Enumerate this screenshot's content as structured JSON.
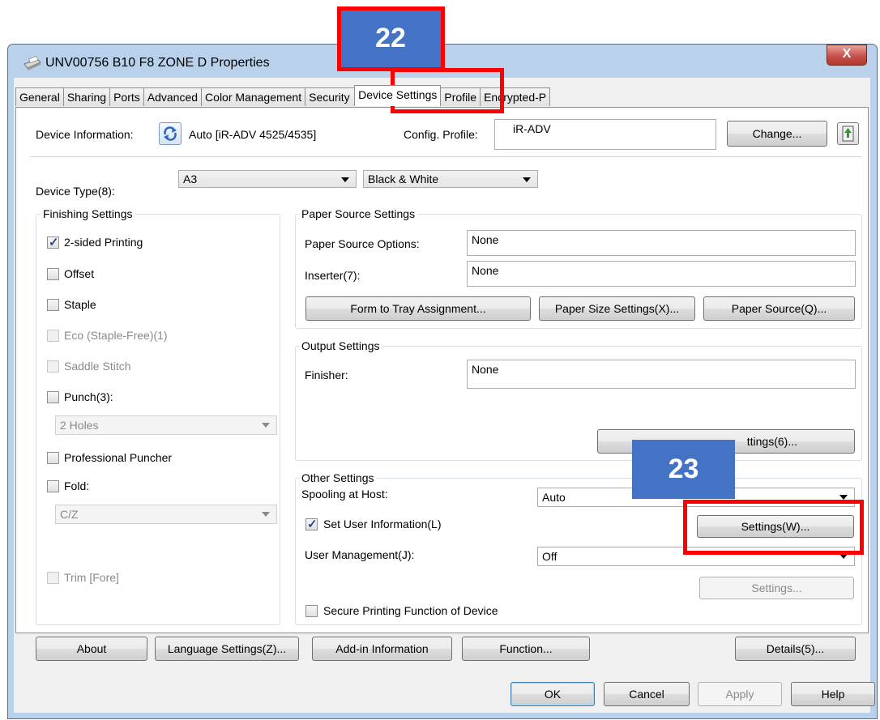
{
  "window": {
    "title": "UNV00756 B10 F8 ZONE D Properties",
    "close_label": "X"
  },
  "tabs": [
    {
      "label": "General"
    },
    {
      "label": "Sharing"
    },
    {
      "label": "Ports"
    },
    {
      "label": "Advanced"
    },
    {
      "label": "Color Management"
    },
    {
      "label": "Security"
    },
    {
      "label": "Device Settings"
    },
    {
      "label": "Profile"
    },
    {
      "label": "Encrypted-P"
    }
  ],
  "device_info": {
    "label": "Device Information:",
    "value": "Auto [iR-ADV 4525/4535]",
    "config_label": "Config. Profile:",
    "config_value": "iR-ADV",
    "change_button": "Change..."
  },
  "device_type": {
    "label": "Device Type(8):",
    "size_value": "A3",
    "color_value": "Black & White"
  },
  "finishing": {
    "title": "Finishing Settings",
    "two_sided": {
      "label": "2-sided Printing",
      "checked": true
    },
    "offset": {
      "label": "Offset",
      "checked": false
    },
    "staple": {
      "label": "Staple",
      "checked": false
    },
    "eco": {
      "label": "Eco (Staple-Free)(1)",
      "checked": false
    },
    "saddle": {
      "label": "Saddle Stitch",
      "checked": false
    },
    "punch": {
      "label": "Punch(3):",
      "checked": false
    },
    "punch_value": "2 Holes",
    "pro_puncher": {
      "label": "Professional Puncher",
      "checked": false
    },
    "fold": {
      "label": "Fold:",
      "checked": false
    },
    "fold_value": "C/Z",
    "trim": {
      "label": "Trim [Fore]",
      "checked": false
    }
  },
  "paper_source": {
    "title": "Paper Source Settings",
    "options_label": "Paper Source Options:",
    "options_value": "None",
    "inserter_label": "Inserter(7):",
    "inserter_value": "None",
    "form_to_tray": "Form to Tray Assignment...",
    "paper_size": "Paper Size Settings(X)...",
    "paper_source_btn": "Paper Source(Q)..."
  },
  "output": {
    "title": "Output Settings",
    "finisher_label": "Finisher:",
    "finisher_value": "None",
    "settings_button": "ttings(6)..."
  },
  "other": {
    "title": "Other Settings",
    "spooling_label": "Spooling at Host:",
    "spooling_value": "Auto",
    "set_user_info": {
      "label": "Set User Information(L)",
      "checked": true
    },
    "settings_w": "Settings(W)...",
    "user_mgmt_label": "User Management(J):",
    "user_mgmt_value": "Off",
    "settings_disabled": "Settings...",
    "secure_printing": {
      "label": "Secure Printing Function of Device",
      "checked": false
    }
  },
  "bottom_buttons": {
    "about": "About",
    "language": "Language Settings(Z)...",
    "addin": "Add-in Information",
    "function": "Function...",
    "details": "Details(5)..."
  },
  "dialog_buttons": {
    "ok": "OK",
    "cancel": "Cancel",
    "apply": "Apply",
    "help": "Help"
  },
  "callouts": {
    "step_a": "22",
    "step_b": "23",
    "color": "#ff0000",
    "badge_color": "#4472c4"
  }
}
